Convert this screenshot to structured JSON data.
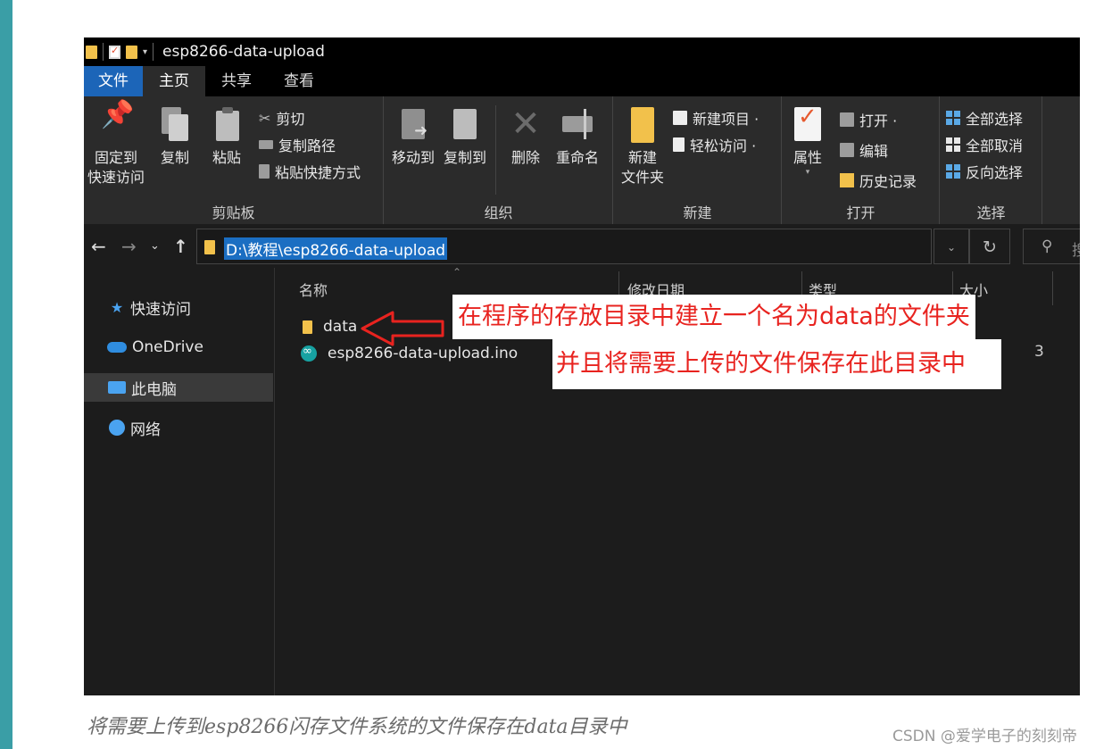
{
  "window": {
    "title": "esp8266-data-upload"
  },
  "tabs": [
    "文件",
    "主页",
    "共享",
    "查看"
  ],
  "ribbon": {
    "clipboard": {
      "label": "剪贴板",
      "pin_line1": "固定到",
      "pin_line2": "快速访问",
      "copy": "复制",
      "paste": "粘贴",
      "cut": "剪切",
      "copy_path": "复制路径",
      "paste_shortcut": "粘贴快捷方式"
    },
    "organize": {
      "label": "组织",
      "move_to": "移动到",
      "copy_to": "复制到",
      "delete": "删除",
      "rename": "重命名"
    },
    "new": {
      "label": "新建",
      "new_item": "新建项目 ·",
      "easy_access": "轻松访问 ·",
      "new_folder_line1": "新建",
      "new_folder_line2": "文件夹"
    },
    "open": {
      "label": "打开",
      "properties": "属性",
      "open": "打开 ·",
      "edit": "编辑",
      "history": "历史记录"
    },
    "select": {
      "label": "选择",
      "select_all": "全部选择",
      "select_none": "全部取消",
      "invert": "反向选择"
    }
  },
  "address": {
    "path": "D:\\教程\\esp8266-data-upload",
    "search_partial": "搜"
  },
  "nav_pane": [
    {
      "label": "快速访问",
      "icon": "star-icon"
    },
    {
      "label": "OneDrive",
      "icon": "cloud-icon"
    },
    {
      "label": "此电脑",
      "icon": "pc-icon"
    },
    {
      "label": "网络",
      "icon": "network-icon"
    }
  ],
  "columns": [
    "名称",
    "修改日期",
    "类型",
    "大小"
  ],
  "files": [
    {
      "name": "data",
      "icon": "folder-icon"
    },
    {
      "name": "esp8266-data-upload.ino",
      "icon": "arduino-file-icon"
    }
  ],
  "clipped_size": "3",
  "annotation": {
    "line1": "在程序的存放目录中建立一个名为data的文件夹",
    "line2": "并且将需要上传的文件保存在此目录中",
    "color": "#e8231f"
  },
  "caption": "将需要上传到esp8266闪存文件系统的文件保存在data目录中",
  "watermark": "CSDN @爱学电子的刻刻帝"
}
